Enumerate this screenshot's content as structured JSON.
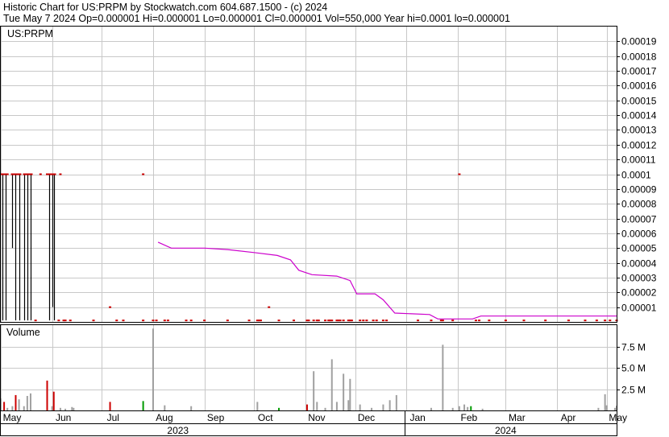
{
  "header": {
    "line1": "Historic Chart for US:PRPM by Stockwatch.com 604.687.1500 - (c) 2024",
    "line2": "Tue May  7 2024   Op=0.000001   Hi=0.000001   Lo=0.000001   Cl=0.000001   Vol=550,000   Year hi=0.0001   lo=0.000001"
  },
  "colors": {
    "background": "#ffffff",
    "grid": "#c8c8c8",
    "price_marks": "#cc0000",
    "moving_average": "#cc00cc",
    "volume_default": "#a0a0a0",
    "volume_down": "#cc0000",
    "volume_up": "#009900"
  },
  "chart_data": [
    {
      "type": "line",
      "panel": "price",
      "symbol_label": "US:PRPM",
      "x_axis": {
        "type": "date",
        "range": [
          "2023-05-01",
          "2024-05-07"
        ],
        "month_labels": [
          {
            "label": "May",
            "date": "2023-05-01"
          },
          {
            "label": "Jun",
            "date": "2023-06-01"
          },
          {
            "label": "Jul",
            "date": "2023-07-01"
          },
          {
            "label": "Aug",
            "date": "2023-08-01"
          },
          {
            "label": "Sep",
            "date": "2023-09-01"
          },
          {
            "label": "Oct",
            "date": "2023-10-01"
          },
          {
            "label": "Nov",
            "date": "2023-11-01"
          },
          {
            "label": "Dec",
            "date": "2023-12-01"
          },
          {
            "label": "Jan",
            "date": "2024-01-01"
          },
          {
            "label": "Feb",
            "date": "2024-02-01"
          },
          {
            "label": "Mar",
            "date": "2024-03-01"
          },
          {
            "label": "Apr",
            "date": "2024-04-01"
          },
          {
            "label": "May",
            "date": "2024-05-01"
          }
        ],
        "year_labels": [
          {
            "label": "2023",
            "date": "2023-08-16"
          },
          {
            "label": "2024",
            "date": "2024-03-01"
          }
        ],
        "year_divider": "2023-12-31"
      },
      "y_axis": {
        "range": [
          0,
          0.0002
        ],
        "ticks": [
          "0.00001",
          "0.00002",
          "0.00003",
          "0.00004",
          "0.00005",
          "0.00006",
          "0.00007",
          "0.00008",
          "0.00009",
          "0.0001",
          "0.00011",
          "0.00012",
          "0.00013",
          "0.00014",
          "0.00015",
          "0.00016",
          "0.00017",
          "0.00018",
          "0.00019"
        ]
      },
      "grid": true,
      "range_bars": [
        {
          "date": "2023-05-02",
          "high": 0.0001,
          "low": 1e-06
        },
        {
          "date": "2023-05-04",
          "high": 0.0001,
          "low": 1e-06
        },
        {
          "date": "2023-05-08",
          "high": 0.0001,
          "low": 5e-05
        },
        {
          "date": "2023-05-10",
          "high": 0.0001,
          "low": 1e-06
        },
        {
          "date": "2023-05-12",
          "high": 0.0001,
          "low": 1e-06
        },
        {
          "date": "2023-05-15",
          "high": 0.0001,
          "low": 1e-06
        },
        {
          "date": "2023-05-17",
          "high": 0.0001,
          "low": 1e-06
        },
        {
          "date": "2023-05-19",
          "high": 0.0001,
          "low": 1e-06
        },
        {
          "date": "2023-05-30",
          "high": 0.0001,
          "low": 1e-06
        },
        {
          "date": "2023-06-01",
          "high": 0.0001,
          "low": 1e-05
        },
        {
          "date": "2023-06-02",
          "high": 0.0001,
          "low": 1e-06
        }
      ],
      "close_marks": [
        {
          "date": "2023-05-01",
          "value": 0.0001
        },
        {
          "date": "2023-05-03",
          "value": 0.0001
        },
        {
          "date": "2023-05-05",
          "value": 0.0001
        },
        {
          "date": "2023-05-09",
          "value": 0.0001
        },
        {
          "date": "2023-05-11",
          "value": 0.0001
        },
        {
          "date": "2023-05-16",
          "value": 0.0001
        },
        {
          "date": "2023-05-18",
          "value": 0.0001
        },
        {
          "date": "2023-05-25",
          "value": 0.0001
        },
        {
          "date": "2023-05-29",
          "value": 0.0001
        },
        {
          "date": "2023-06-01",
          "value": 0.0001
        },
        {
          "date": "2023-06-06",
          "value": 0.0001
        },
        {
          "date": "2023-07-26",
          "value": 0.0001
        },
        {
          "date": "2024-02-02",
          "value": 0.0001
        },
        {
          "date": "2023-07-06",
          "value": 1e-05
        },
        {
          "date": "2023-10-10",
          "value": 1e-05
        },
        {
          "date": "2023-05-22",
          "value": 1e-06
        },
        {
          "date": "2023-06-05",
          "value": 1e-06
        },
        {
          "date": "2023-06-08",
          "value": 1e-06
        },
        {
          "date": "2023-06-09",
          "value": 1e-06
        },
        {
          "date": "2023-06-12",
          "value": 1e-06
        },
        {
          "date": "2023-06-26",
          "value": 1e-06
        },
        {
          "date": "2023-07-10",
          "value": 1e-06
        },
        {
          "date": "2023-07-14",
          "value": 1e-06
        },
        {
          "date": "2023-07-26",
          "value": 1e-06
        },
        {
          "date": "2023-08-01",
          "value": 1e-06
        },
        {
          "date": "2023-08-03",
          "value": 1e-06
        },
        {
          "date": "2023-08-08",
          "value": 1e-06
        },
        {
          "date": "2023-08-10",
          "value": 1e-06
        },
        {
          "date": "2023-08-21",
          "value": 1e-06
        },
        {
          "date": "2023-08-24",
          "value": 1e-06
        },
        {
          "date": "2023-09-01",
          "value": 1e-06
        },
        {
          "date": "2023-09-15",
          "value": 1e-06
        },
        {
          "date": "2023-09-28",
          "value": 1e-06
        },
        {
          "date": "2023-10-03",
          "value": 1e-06
        },
        {
          "date": "2023-10-04",
          "value": 1e-06
        },
        {
          "date": "2023-10-05",
          "value": 1e-06
        },
        {
          "date": "2023-10-16",
          "value": 1e-06
        },
        {
          "date": "2023-10-25",
          "value": 1e-06
        },
        {
          "date": "2023-11-02",
          "value": 1e-06
        },
        {
          "date": "2023-11-03",
          "value": 1e-06
        },
        {
          "date": "2023-11-06",
          "value": 1e-06
        },
        {
          "date": "2023-11-08",
          "value": 1e-06
        },
        {
          "date": "2023-11-09",
          "value": 1e-06
        },
        {
          "date": "2023-11-13",
          "value": 1e-06
        },
        {
          "date": "2023-11-15",
          "value": 1e-06
        },
        {
          "date": "2023-11-16",
          "value": 1e-06
        },
        {
          "date": "2023-11-17",
          "value": 1e-06
        },
        {
          "date": "2023-11-20",
          "value": 1e-06
        },
        {
          "date": "2023-11-21",
          "value": 1e-06
        },
        {
          "date": "2023-11-22",
          "value": 1e-06
        },
        {
          "date": "2023-11-24",
          "value": 1e-06
        },
        {
          "date": "2023-11-27",
          "value": 1e-06
        },
        {
          "date": "2023-11-28",
          "value": 1e-06
        },
        {
          "date": "2023-11-29",
          "value": 1e-06
        },
        {
          "date": "2023-12-04",
          "value": 1e-06
        },
        {
          "date": "2023-12-06",
          "value": 1e-06
        },
        {
          "date": "2023-12-08",
          "value": 1e-06
        },
        {
          "date": "2023-12-12",
          "value": 1e-06
        },
        {
          "date": "2023-12-14",
          "value": 1e-06
        },
        {
          "date": "2023-12-18",
          "value": 1e-06
        },
        {
          "date": "2023-12-20",
          "value": 1e-06
        },
        {
          "date": "2024-01-08",
          "value": 1e-06
        },
        {
          "date": "2024-01-16",
          "value": 1e-06
        },
        {
          "date": "2024-01-22",
          "value": 1e-06
        },
        {
          "date": "2024-01-23",
          "value": 1e-06
        },
        {
          "date": "2024-01-29",
          "value": 1e-06
        },
        {
          "date": "2024-02-12",
          "value": 1e-06
        },
        {
          "date": "2024-02-14",
          "value": 1e-06
        },
        {
          "date": "2024-02-20",
          "value": 1e-06
        },
        {
          "date": "2024-03-01",
          "value": 1e-06
        },
        {
          "date": "2024-03-12",
          "value": 1e-06
        },
        {
          "date": "2024-03-25",
          "value": 1e-06
        },
        {
          "date": "2024-04-08",
          "value": 1e-06
        },
        {
          "date": "2024-04-18",
          "value": 1e-06
        },
        {
          "date": "2024-04-25",
          "value": 1e-06
        },
        {
          "date": "2024-04-30",
          "value": 1e-06
        },
        {
          "date": "2024-05-03",
          "value": 1e-06
        },
        {
          "date": "2024-05-07",
          "value": 1e-06
        }
      ],
      "moving_average": [
        {
          "date": "2023-08-04",
          "value": 5.4e-05
        },
        {
          "date": "2023-08-12",
          "value": 5e-05
        },
        {
          "date": "2023-09-01",
          "value": 5e-05
        },
        {
          "date": "2023-09-15",
          "value": 4.9e-05
        },
        {
          "date": "2023-10-01",
          "value": 4.7e-05
        },
        {
          "date": "2023-10-15",
          "value": 4.5e-05
        },
        {
          "date": "2023-10-23",
          "value": 4.2e-05
        },
        {
          "date": "2023-10-28",
          "value": 3.5e-05
        },
        {
          "date": "2023-11-05",
          "value": 3.2e-05
        },
        {
          "date": "2023-11-20",
          "value": 3.1e-05
        },
        {
          "date": "2023-11-28",
          "value": 2.8e-05
        },
        {
          "date": "2023-12-02",
          "value": 1.9e-05
        },
        {
          "date": "2023-12-13",
          "value": 1.9e-05
        },
        {
          "date": "2023-12-18",
          "value": 1.5e-05
        },
        {
          "date": "2023-12-25",
          "value": 6e-06
        },
        {
          "date": "2024-01-15",
          "value": 5e-06
        },
        {
          "date": "2024-01-20",
          "value": 2e-06
        },
        {
          "date": "2024-02-10",
          "value": 2e-06
        },
        {
          "date": "2024-02-15",
          "value": 4e-06
        },
        {
          "date": "2024-05-07",
          "value": 4e-06
        }
      ]
    },
    {
      "type": "bar",
      "panel": "volume",
      "title": "Volume",
      "y_axis": {
        "range": [
          0,
          10000000
        ],
        "ticks": [
          "2.5 M",
          "5.0 M",
          "7.5 M"
        ]
      },
      "grid": true,
      "bars": [
        {
          "date": "2023-05-01",
          "value": 1400000,
          "color": "gray"
        },
        {
          "date": "2023-05-03",
          "value": 1000000,
          "color": "red"
        },
        {
          "date": "2023-05-05",
          "value": 300000,
          "color": "gray"
        },
        {
          "date": "2023-05-08",
          "value": 500000,
          "color": "gray"
        },
        {
          "date": "2023-05-10",
          "value": 1800000,
          "color": "red"
        },
        {
          "date": "2023-05-12",
          "value": 1300000,
          "color": "gray"
        },
        {
          "date": "2023-05-15",
          "value": 500000,
          "color": "gray"
        },
        {
          "date": "2023-05-17",
          "value": 1700000,
          "color": "gray"
        },
        {
          "date": "2023-05-19",
          "value": 2000000,
          "color": "gray"
        },
        {
          "date": "2023-05-29",
          "value": 3500000,
          "color": "red"
        },
        {
          "date": "2023-06-01",
          "value": 500000,
          "color": "gray"
        },
        {
          "date": "2023-06-02",
          "value": 2200000,
          "color": "red"
        },
        {
          "date": "2023-06-06",
          "value": 300000,
          "color": "gray"
        },
        {
          "date": "2023-06-09",
          "value": 200000,
          "color": "gray"
        },
        {
          "date": "2023-06-13",
          "value": 400000,
          "color": "gray"
        },
        {
          "date": "2023-06-14",
          "value": 300000,
          "color": "gray"
        },
        {
          "date": "2023-07-06",
          "value": 1000000,
          "color": "red"
        },
        {
          "date": "2023-07-26",
          "value": 1100000,
          "color": "green"
        },
        {
          "date": "2023-08-01",
          "value": 9600000,
          "color": "gray"
        },
        {
          "date": "2023-08-08",
          "value": 600000,
          "color": "gray"
        },
        {
          "date": "2023-08-24",
          "value": 500000,
          "color": "gray"
        },
        {
          "date": "2023-10-03",
          "value": 1000000,
          "color": "gray"
        },
        {
          "date": "2023-10-16",
          "value": 300000,
          "color": "green"
        },
        {
          "date": "2023-11-02",
          "value": 700000,
          "color": "red"
        },
        {
          "date": "2023-11-06",
          "value": 4600000,
          "color": "gray"
        },
        {
          "date": "2023-11-08",
          "value": 1000000,
          "color": "gray"
        },
        {
          "date": "2023-11-13",
          "value": 300000,
          "color": "gray"
        },
        {
          "date": "2023-11-17",
          "value": 6000000,
          "color": "gray"
        },
        {
          "date": "2023-11-20",
          "value": 1000000,
          "color": "gray"
        },
        {
          "date": "2023-11-24",
          "value": 4300000,
          "color": "gray"
        },
        {
          "date": "2023-11-27",
          "value": 1200000,
          "color": "gray"
        },
        {
          "date": "2023-11-28",
          "value": 3700000,
          "color": "gray"
        },
        {
          "date": "2023-12-04",
          "value": 700000,
          "color": "gray"
        },
        {
          "date": "2023-12-11",
          "value": 300000,
          "color": "gray"
        },
        {
          "date": "2023-12-18",
          "value": 700000,
          "color": "gray"
        },
        {
          "date": "2023-12-22",
          "value": 1200000,
          "color": "gray"
        },
        {
          "date": "2023-12-26",
          "value": 1800000,
          "color": "gray"
        },
        {
          "date": "2024-01-16",
          "value": 300000,
          "color": "gray"
        },
        {
          "date": "2024-01-23",
          "value": 7700000,
          "color": "gray"
        },
        {
          "date": "2024-01-29",
          "value": 300000,
          "color": "gray"
        },
        {
          "date": "2024-02-02",
          "value": 500000,
          "color": "gray"
        },
        {
          "date": "2024-02-05",
          "value": 700000,
          "color": "gray"
        },
        {
          "date": "2024-02-07",
          "value": 400000,
          "color": "gray"
        },
        {
          "date": "2024-02-09",
          "value": 500000,
          "color": "green"
        },
        {
          "date": "2024-02-16",
          "value": 200000,
          "color": "gray"
        },
        {
          "date": "2024-04-26",
          "value": 300000,
          "color": "gray"
        },
        {
          "date": "2024-04-30",
          "value": 1900000,
          "color": "gray"
        },
        {
          "date": "2024-05-01",
          "value": 600000,
          "color": "gray"
        },
        {
          "date": "2024-05-06",
          "value": 300000,
          "color": "gray"
        },
        {
          "date": "2024-05-07",
          "value": 550000,
          "color": "gray"
        }
      ]
    }
  ]
}
